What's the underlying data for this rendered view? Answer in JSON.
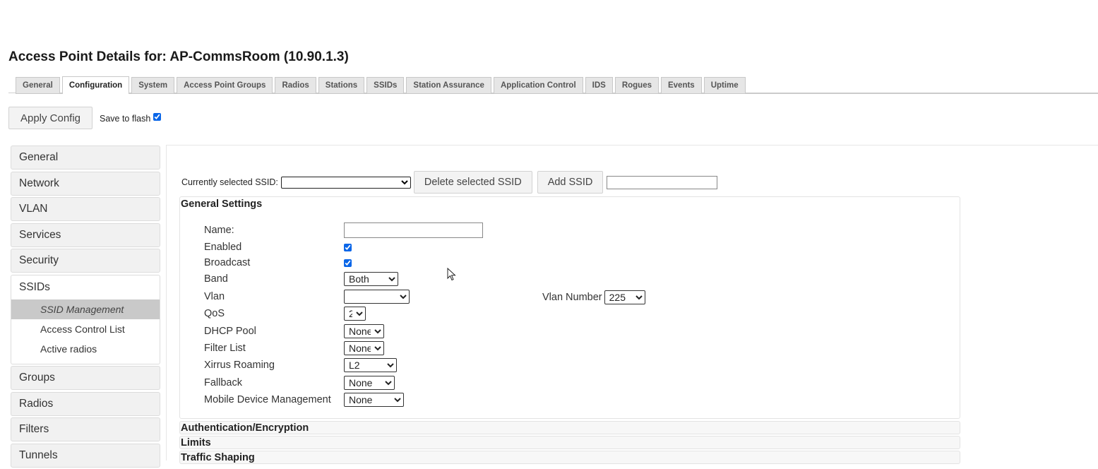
{
  "page": {
    "title": "Access Point Details for: AP-CommsRoom (10.90.1.3)"
  },
  "tabs": [
    {
      "label": "General"
    },
    {
      "label": "Configuration"
    },
    {
      "label": "System"
    },
    {
      "label": "Access Point Groups"
    },
    {
      "label": "Radios"
    },
    {
      "label": "Stations"
    },
    {
      "label": "SSIDs"
    },
    {
      "label": "Station Assurance"
    },
    {
      "label": "Application Control"
    },
    {
      "label": "IDS"
    },
    {
      "label": "Rogues"
    },
    {
      "label": "Events"
    },
    {
      "label": "Uptime"
    }
  ],
  "active_tab": "Configuration",
  "toolbar": {
    "apply_label": "Apply Config",
    "save_flash_label": "Save to flash",
    "save_flash_checked": true
  },
  "sidebar": {
    "items_top": [
      {
        "label": "General"
      },
      {
        "label": "Network"
      },
      {
        "label": "VLAN"
      },
      {
        "label": "Services"
      },
      {
        "label": "Security"
      }
    ],
    "ssids": {
      "label": "SSIDs",
      "children": [
        {
          "label": "SSID Management"
        },
        {
          "label": "Access Control List"
        },
        {
          "label": "Active radios"
        }
      ],
      "active_child": "SSID Management"
    },
    "items_bottom": [
      {
        "label": "Groups"
      },
      {
        "label": "Radios"
      },
      {
        "label": "Filters"
      },
      {
        "label": "Tunnels"
      }
    ]
  },
  "ssid_bar": {
    "current_label": "Currently selected SSID:",
    "current_value": "",
    "delete_label": "Delete selected SSID",
    "add_label": "Add SSID",
    "new_ssid_value": ""
  },
  "general_settings": {
    "title": "General Settings",
    "name": {
      "label": "Name:",
      "value": ""
    },
    "enabled": {
      "label": "Enabled",
      "checked": true
    },
    "broadcast": {
      "label": "Broadcast",
      "checked": true
    },
    "band": {
      "label": "Band",
      "value": "Both"
    },
    "vlan": {
      "label": "Vlan",
      "value": ""
    },
    "vlan_number": {
      "label": "Vlan Number",
      "value": "225"
    },
    "qos": {
      "label": "QoS",
      "value": "2"
    },
    "dhcp_pool": {
      "label": "DHCP Pool",
      "value": "None"
    },
    "filter_list": {
      "label": "Filter List",
      "value": "None"
    },
    "xirrus_roaming": {
      "label": "Xirrus Roaming",
      "value": "L2"
    },
    "fallback": {
      "label": "Fallback",
      "value": "None"
    },
    "mdm": {
      "label": "Mobile Device Management",
      "value": "None"
    }
  },
  "sections": [
    {
      "label": "Authentication/Encryption"
    },
    {
      "label": "Limits"
    },
    {
      "label": "Traffic Shaping"
    }
  ],
  "colors": {
    "checkbox": "#0a66e8",
    "active_subitem": "#c9c9c9"
  },
  "icons": {
    "cursor": "mouse-pointer-icon"
  }
}
